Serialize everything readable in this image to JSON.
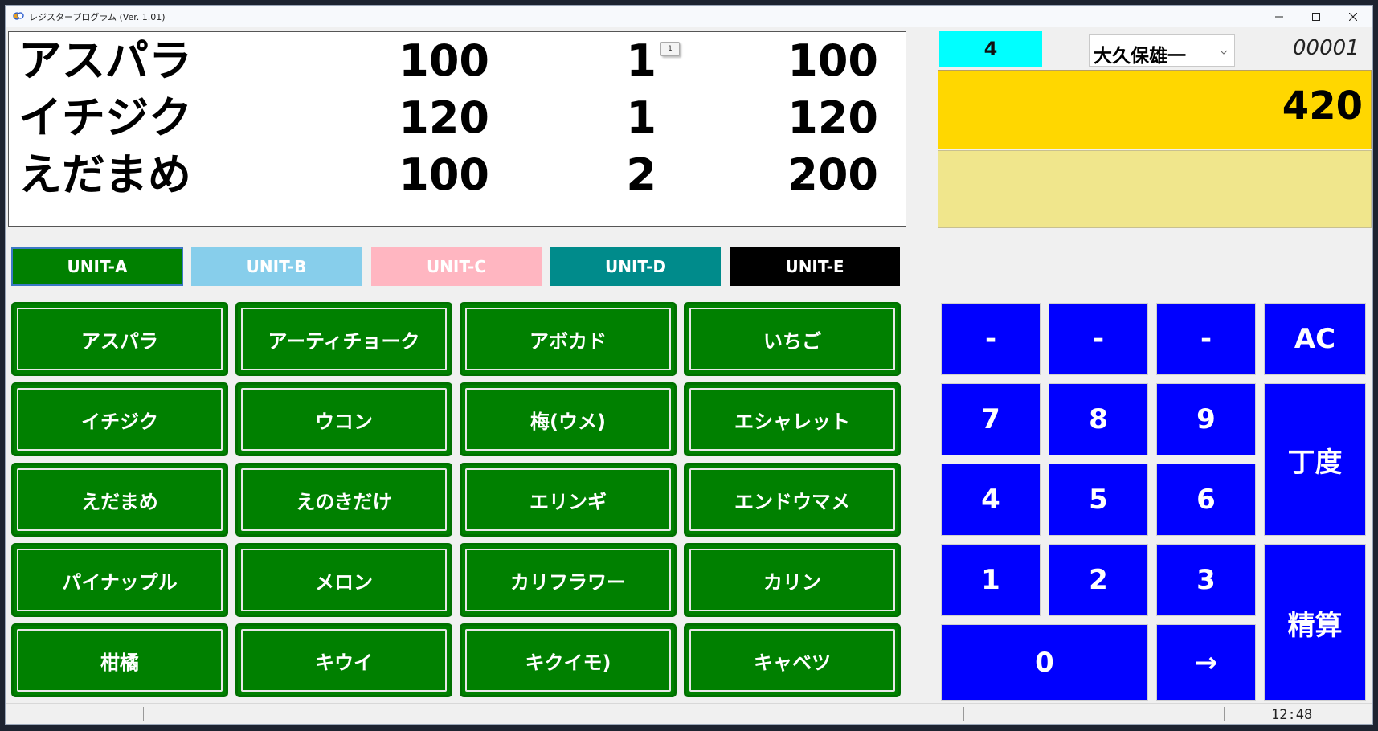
{
  "window": {
    "title": "レジスタープログラム (Ver. 1.01)"
  },
  "receipt": {
    "tooltip": "1",
    "lines": [
      {
        "name": "アスパラ",
        "price": "100",
        "qty": "1",
        "total": "100"
      },
      {
        "name": "イチジク",
        "price": "120",
        "qty": "1",
        "total": "120"
      },
      {
        "name": "えだまめ",
        "price": "100",
        "qty": "2",
        "total": "200"
      }
    ]
  },
  "summary": {
    "item_count": "4",
    "staff": "大久保雄一",
    "receipt_no": "00001",
    "total": "420",
    "sub_display": ""
  },
  "units": [
    {
      "label": "UNIT-A",
      "color": "#008000",
      "selected": true
    },
    {
      "label": "UNIT-B",
      "color": "#87ceeb",
      "selected": false
    },
    {
      "label": "UNIT-C",
      "color": "#ffb6c1",
      "selected": false
    },
    {
      "label": "UNIT-D",
      "color": "#008b8b",
      "selected": false
    },
    {
      "label": "UNIT-E",
      "color": "#000000",
      "selected": false
    }
  ],
  "products": [
    [
      "アスパラ",
      "アーティチョーク",
      "アボカド",
      "いちご"
    ],
    [
      "イチジク",
      "ウコン",
      "梅(ウメ)",
      "エシャレット"
    ],
    [
      "えだまめ",
      "えのきだけ",
      "エリンギ",
      "エンドウマメ"
    ],
    [
      "パイナップル",
      "メロン",
      "カリフラワー",
      "カリン"
    ],
    [
      "柑橘",
      "キウイ",
      "キクイモ)",
      "キャベツ"
    ]
  ],
  "keypad": {
    "dash": "-",
    "ac": "AC",
    "exact": "丁度",
    "checkout": "精算",
    "arrow": "→",
    "digits": [
      "0",
      "1",
      "2",
      "3",
      "4",
      "5",
      "6",
      "7",
      "8",
      "9"
    ]
  },
  "status": {
    "clock": "12:48"
  },
  "colors": {
    "product_button": "#008000",
    "keypad": "#0000ff",
    "total_bg": "#ffd700",
    "sub_bg": "#f0e68c",
    "count_bg": "#00ffff"
  }
}
